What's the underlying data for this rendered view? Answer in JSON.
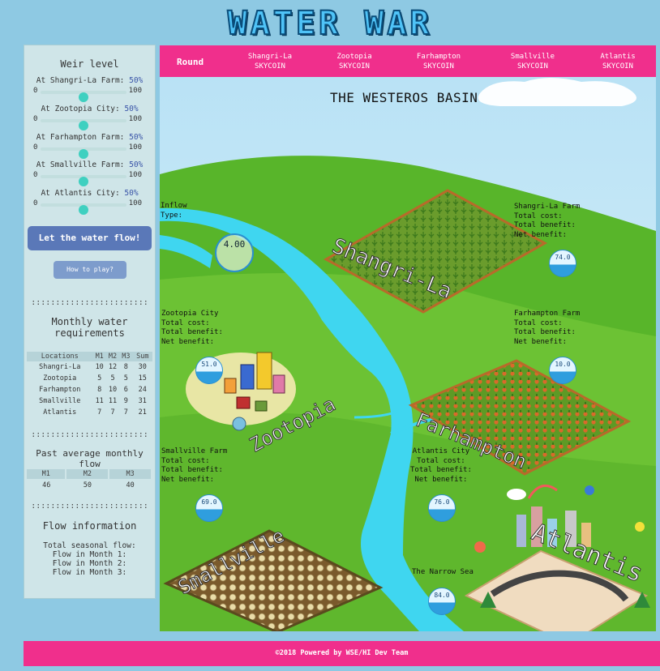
{
  "title": "WATER WAR",
  "weir": {
    "heading": "Weir level",
    "min": "0",
    "max": "100",
    "items": [
      {
        "label": "At Shangri-La Farm: ",
        "pct": "50%",
        "value": 50
      },
      {
        "label": "At Zootopia City: ",
        "pct": "50%",
        "value": 50
      },
      {
        "label": "At Farhampton Farm: ",
        "pct": "50%",
        "value": 50
      },
      {
        "label": "At Smallville Farm: ",
        "pct": "50%",
        "value": 50
      },
      {
        "label": "At Atlantis City: ",
        "pct": "50%",
        "value": 50
      }
    ]
  },
  "buttons": {
    "flow": "Let the water flow!",
    "howto": "How to play?"
  },
  "dots": "::::::::::::::::::::::::",
  "requirements": {
    "heading": "Monthly water requirements",
    "headers": [
      "Locations",
      "M1",
      "M2",
      "M3",
      "Sum"
    ],
    "rows": [
      [
        "Shangri-La",
        "10",
        "12",
        "8",
        "30"
      ],
      [
        "Zootopia",
        "5",
        "5",
        "5",
        "15"
      ],
      [
        "Farhampton",
        "8",
        "10",
        "6",
        "24"
      ],
      [
        "Smallville",
        "11",
        "11",
        "9",
        "31"
      ],
      [
        "Atlantis",
        "7",
        "7",
        "7",
        "21"
      ]
    ]
  },
  "past_flow": {
    "heading": "Past average monthly flow",
    "headers": [
      "M1",
      "M2",
      "M3"
    ],
    "values": [
      "46",
      "50",
      "40"
    ]
  },
  "flow_info": {
    "heading": "Flow information",
    "lines": [
      "Total seasonal flow:",
      "Flow in Month 1:",
      "Flow in Month 2:",
      "Flow in Month 3:"
    ]
  },
  "topbar": {
    "round": "Round",
    "columns": [
      {
        "name": "Shangri-La",
        "unit": "SKYCOIN"
      },
      {
        "name": "Zootopia",
        "unit": "SKYCOIN"
      },
      {
        "name": "Farhampton",
        "unit": "SKYCOIN"
      },
      {
        "name": "Smallville",
        "unit": "SKYCOIN"
      },
      {
        "name": "Atlantis",
        "unit": "SKYCOIN"
      }
    ]
  },
  "map": {
    "title": "THE WESTEROS BASIN",
    "inflow": {
      "label": "Inflow",
      "type": "Type:",
      "value": "4.00"
    },
    "stat_labels": {
      "cost": "Total cost:",
      "benefit": "Total benefit:",
      "net": "Net benefit:"
    },
    "places": [
      {
        "name": "Shangri-La Farm",
        "badge": "74.0",
        "sign": "Shangri-La"
      },
      {
        "name": "Zootopia City",
        "badge": "51.0",
        "sign": "Zootopia"
      },
      {
        "name": "Farhampton Farm",
        "badge": "10.0",
        "sign": "Farhampton"
      },
      {
        "name": "Smallville Farm",
        "badge": "69.0",
        "sign": "Smallville"
      },
      {
        "name": "Atlantis City",
        "badge": "76.0",
        "sign": "Atlantis"
      }
    ],
    "sea": {
      "name": "The Narrow Sea",
      "badge": "84.0"
    }
  },
  "footer": "©2018 Powered by WSE/HI Dev Team",
  "colors": {
    "accent": "#f02f8c",
    "button": "#5a78b8",
    "slider": "#3fd0c0",
    "river": "#3fd6f0",
    "grass": "#5cb82a"
  }
}
